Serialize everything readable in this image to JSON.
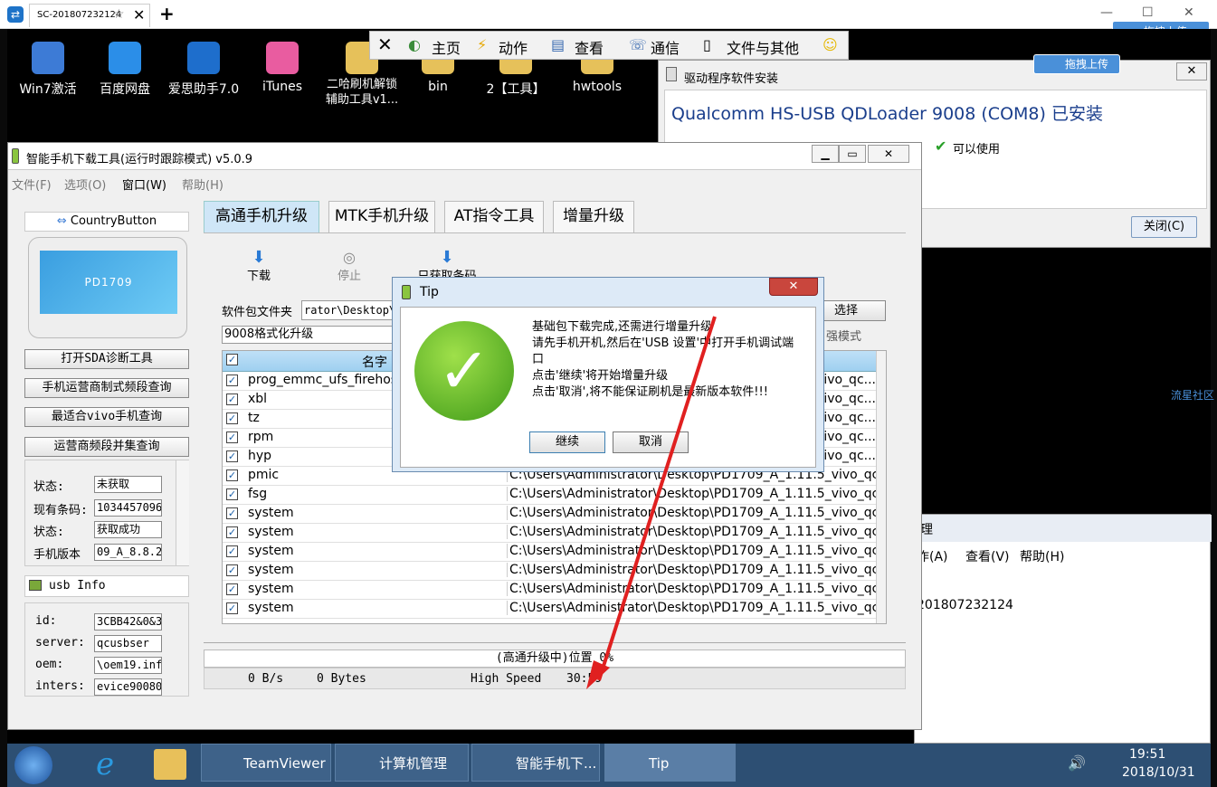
{
  "teamviewer": {
    "tab_title": "SC-201807232124",
    "upload_label": "拖拽上传"
  },
  "desktop_icons": [
    "Win7激活",
    "百度网盘",
    "爱思助手7.0",
    "iTunes",
    "二哈刷机解锁辅助工具v1...",
    "bin",
    "2【工具】",
    "hwtools"
  ],
  "remote_toolbar": {
    "home": "主页",
    "action": "动作",
    "view": "查看",
    "comm": "通信",
    "files": "文件与其他"
  },
  "driver_window": {
    "title": "驱动程序软件安装",
    "device": "Qualcomm HS-USB QDLoader 9008 (COM8) 已安装",
    "status": "可以使用",
    "close_label": "关闭(C)",
    "upload_label": "拖拽上传"
  },
  "main_window": {
    "title": "智能手机下载工具(运行时跟踪模式) v5.0.9",
    "menu": [
      "文件(F)",
      "选项(O)",
      "窗口(W)",
      "帮助(H)"
    ],
    "country_button": "CountryButton",
    "phone_model": "PD1709",
    "left_buttons": [
      "打开SDA诊断工具",
      "手机运营商制式频段查询",
      "最适合vivo手机查询",
      "运营商频段并集查询"
    ],
    "fields": [
      {
        "label": "状态:",
        "value": "未获取"
      },
      {
        "label": "现有条码:",
        "value": "1034457096"
      },
      {
        "label": "状态:",
        "value": "获取成功"
      },
      {
        "label": "手机版本",
        "value": "09_A_8.8.2"
      }
    ],
    "usb_info_title": "usb Info",
    "usb_fields": [
      {
        "label": "id:",
        "value": "3CBB42&0&3"
      },
      {
        "label": "server:",
        "value": "qcusbser"
      },
      {
        "label": "oem:",
        "value": "\\oem19.inf"
      },
      {
        "label": "inters:",
        "value": "evice90080"
      }
    ],
    "tabs": [
      "高通手机升级",
      "MTK手机升级",
      "AT指令工具",
      "增量升级"
    ],
    "toolbar": {
      "download": "下载",
      "stop": "停止",
      "fetch": "只获取条码"
    },
    "package_label": "软件包文件夹",
    "package_path": "rator\\Desktop\\",
    "select_label": "选择",
    "mode_value": "9008格式化升级",
    "enhance_label": "强模式",
    "col_name": "名字",
    "rows": [
      {
        "name": "prog_emmc_ufs_firehose",
        "path": "vivo_qc..."
      },
      {
        "name": "xbl",
        "path": "vivo_qc..."
      },
      {
        "name": "tz",
        "path": "vivo_qc..."
      },
      {
        "name": "rpm",
        "path": "vivo_qc..."
      },
      {
        "name": "hyp",
        "path": "vivo_qc..."
      },
      {
        "name": "pmic",
        "path": "C:\\Users\\Administrator\\Desktop\\PD1709_A_1.11.5_vivo_qc..."
      },
      {
        "name": "fsg",
        "path": "C:\\Users\\Administrator\\Desktop\\PD1709_A_1.11.5_vivo_qc..."
      },
      {
        "name": "system",
        "path": "C:\\Users\\Administrator\\Desktop\\PD1709_A_1.11.5_vivo_qc..."
      },
      {
        "name": "system",
        "path": "C:\\Users\\Administrator\\Desktop\\PD1709_A_1.11.5_vivo_qc..."
      },
      {
        "name": "system",
        "path": "C:\\Users\\Administrator\\Desktop\\PD1709_A_1.11.5_vivo_qc..."
      },
      {
        "name": "system",
        "path": "C:\\Users\\Administrator\\Desktop\\PD1709_A_1.11.5_vivo_qc..."
      },
      {
        "name": "system",
        "path": "C:\\Users\\Administrator\\Desktop\\PD1709_A_1.11.5_vivo_qc..."
      },
      {
        "name": "system",
        "path": "C:\\Users\\Administrator\\Desktop\\PD1709_A_1.11.5_vivo_qc..."
      }
    ],
    "progress_text": "(高通升级中)位置 0%",
    "status_bar": {
      "speed": "0 B/s",
      "bytes": "0 Bytes",
      "mode": "High Speed",
      "time": "30:59"
    }
  },
  "tip_dialog": {
    "title": "Tip",
    "lines": [
      "基础包下载完成,还需进行增量升级",
      "请先手机开机,然后在'USB 设置'中打开手机调试端口",
      "点击'继续'将开始增量升级",
      "点击'取消',将不能保证刷机是最新版本软件!!!"
    ],
    "continue_label": "继续",
    "cancel_label": "取消"
  },
  "side_text": {
    "community": "流星社区",
    "mgmt_menu": [
      "作(A)",
      "查看(V)",
      "帮助(H)"
    ],
    "mgmt_title": "理",
    "computer_name": "201807232124"
  },
  "taskbar": {
    "items": [
      "TeamViewer",
      "计算机管理",
      "智能手机下...",
      "Tip"
    ],
    "time": "19:51",
    "date": "2018/10/31"
  }
}
